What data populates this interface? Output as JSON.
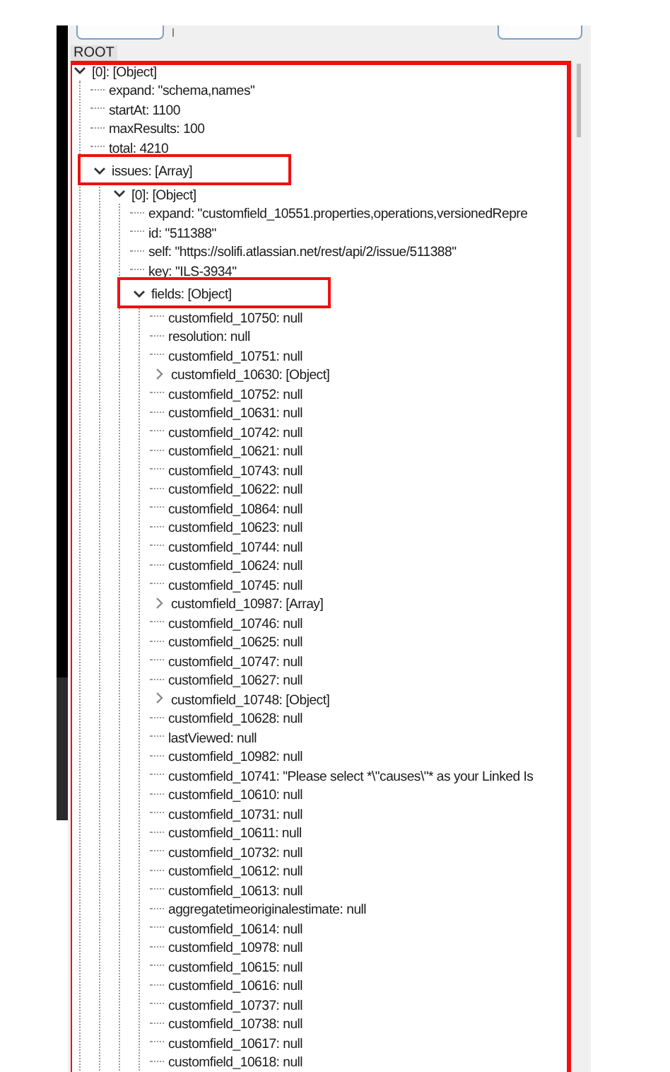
{
  "panel": {
    "root_label": "ROOT"
  },
  "tree": [
    {
      "label": "[0]: [Object]",
      "expanded": true,
      "outlined": true,
      "children": [
        {
          "label": "expand: \"schema,names\""
        },
        {
          "label": "startAt: 1100"
        },
        {
          "label": "maxResults: 100"
        },
        {
          "label": "total: 4210"
        },
        {
          "label": "issues: [Array]",
          "expanded": true,
          "highlighted": true,
          "children": [
            {
              "label": "[0]: [Object]",
              "expanded": true,
              "children": [
                {
                  "label": "expand: \"customfield_10551.properties,operations,versionedRepre"
                },
                {
                  "label": "id: \"511388\""
                },
                {
                  "label": "self: \"https://solifi.atlassian.net/rest/api/2/issue/511388\""
                },
                {
                  "label": "key: \"ILS-3934\""
                },
                {
                  "label": "fields: [Object]",
                  "expanded": true,
                  "highlighted": true,
                  "children": [
                    {
                      "label": "customfield_10750: null"
                    },
                    {
                      "label": "resolution: null"
                    },
                    {
                      "label": "customfield_10751: null"
                    },
                    {
                      "label": "customfield_10630: [Object]",
                      "expanded": false
                    },
                    {
                      "label": "customfield_10752: null"
                    },
                    {
                      "label": "customfield_10631: null"
                    },
                    {
                      "label": "customfield_10742: null"
                    },
                    {
                      "label": "customfield_10621: null"
                    },
                    {
                      "label": "customfield_10743: null"
                    },
                    {
                      "label": "customfield_10622: null"
                    },
                    {
                      "label": "customfield_10864: null"
                    },
                    {
                      "label": "customfield_10623: null"
                    },
                    {
                      "label": "customfield_10744: null"
                    },
                    {
                      "label": "customfield_10624: null"
                    },
                    {
                      "label": "customfield_10745: null"
                    },
                    {
                      "label": "customfield_10987: [Array]",
                      "expanded": false
                    },
                    {
                      "label": "customfield_10746: null"
                    },
                    {
                      "label": "customfield_10625: null"
                    },
                    {
                      "label": "customfield_10747: null"
                    },
                    {
                      "label": "customfield_10627: null"
                    },
                    {
                      "label": "customfield_10748: [Object]",
                      "expanded": false
                    },
                    {
                      "label": "customfield_10628: null"
                    },
                    {
                      "label": "lastViewed: null"
                    },
                    {
                      "label": "customfield_10982: null"
                    },
                    {
                      "label": "customfield_10741: \"Please select *\\\"causes\\\"* as your Linked Is"
                    },
                    {
                      "label": "customfield_10610: null"
                    },
                    {
                      "label": "customfield_10731: null"
                    },
                    {
                      "label": "customfield_10611: null"
                    },
                    {
                      "label": "customfield_10732: null"
                    },
                    {
                      "label": "customfield_10612: null"
                    },
                    {
                      "label": "customfield_10613: null"
                    },
                    {
                      "label": "aggregatetimeoriginalestimate: null"
                    },
                    {
                      "label": "customfield_10614: null"
                    },
                    {
                      "label": "customfield_10978: null"
                    },
                    {
                      "label": "customfield_10615: null"
                    },
                    {
                      "label": "customfield_10616: null"
                    },
                    {
                      "label": "customfield_10737: null"
                    },
                    {
                      "label": "customfield_10738: null"
                    },
                    {
                      "label": "customfield_10617: null"
                    },
                    {
                      "label": "customfield_10618: null"
                    }
                  ]
                }
              ]
            }
          ]
        }
      ]
    }
  ]
}
